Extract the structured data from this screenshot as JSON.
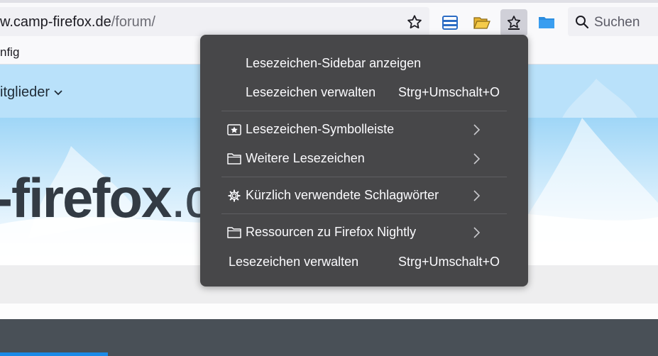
{
  "toolbar": {
    "url_host": "w.camp-firefox.de",
    "url_path": "/forum/",
    "search_placeholder": "Suchen"
  },
  "bookmarks_bar": {
    "item_label": "nfig"
  },
  "page": {
    "nav_label": "itglieder",
    "logo_main": "-firefox",
    "logo_tld": ".d"
  },
  "menu": {
    "items": [
      {
        "label": "Lesezeichen-Sidebar anzeigen",
        "shortcut": ""
      },
      {
        "label": "Lesezeichen verwalten",
        "shortcut": "Strg+Umschalt+O"
      },
      {
        "label": "Lesezeichen-Symbolleiste",
        "shortcut": ""
      },
      {
        "label": "Weitere Lesezeichen",
        "shortcut": ""
      },
      {
        "label": "Kürzlich verwendete Schlagwörter",
        "shortcut": ""
      },
      {
        "label": "Ressourcen zu Firefox Nightly",
        "shortcut": ""
      },
      {
        "label": "Lesezeichen verwalten",
        "shortcut": "Strg+Umschalt+O"
      }
    ]
  },
  "colors": {
    "menu_bg": "#474749",
    "menu_text": "#fbfbfe",
    "accent_blue": "#1b8ae8",
    "footer": "#495057"
  },
  "icons": [
    "star-icon",
    "sidebar-icon",
    "open-folder-icon",
    "bookmarks-menu-icon",
    "folder-icon",
    "search-icon",
    "chevron-down-icon",
    "bookmark-toolbar-icon",
    "chevron-right-icon",
    "gear-icon"
  ]
}
